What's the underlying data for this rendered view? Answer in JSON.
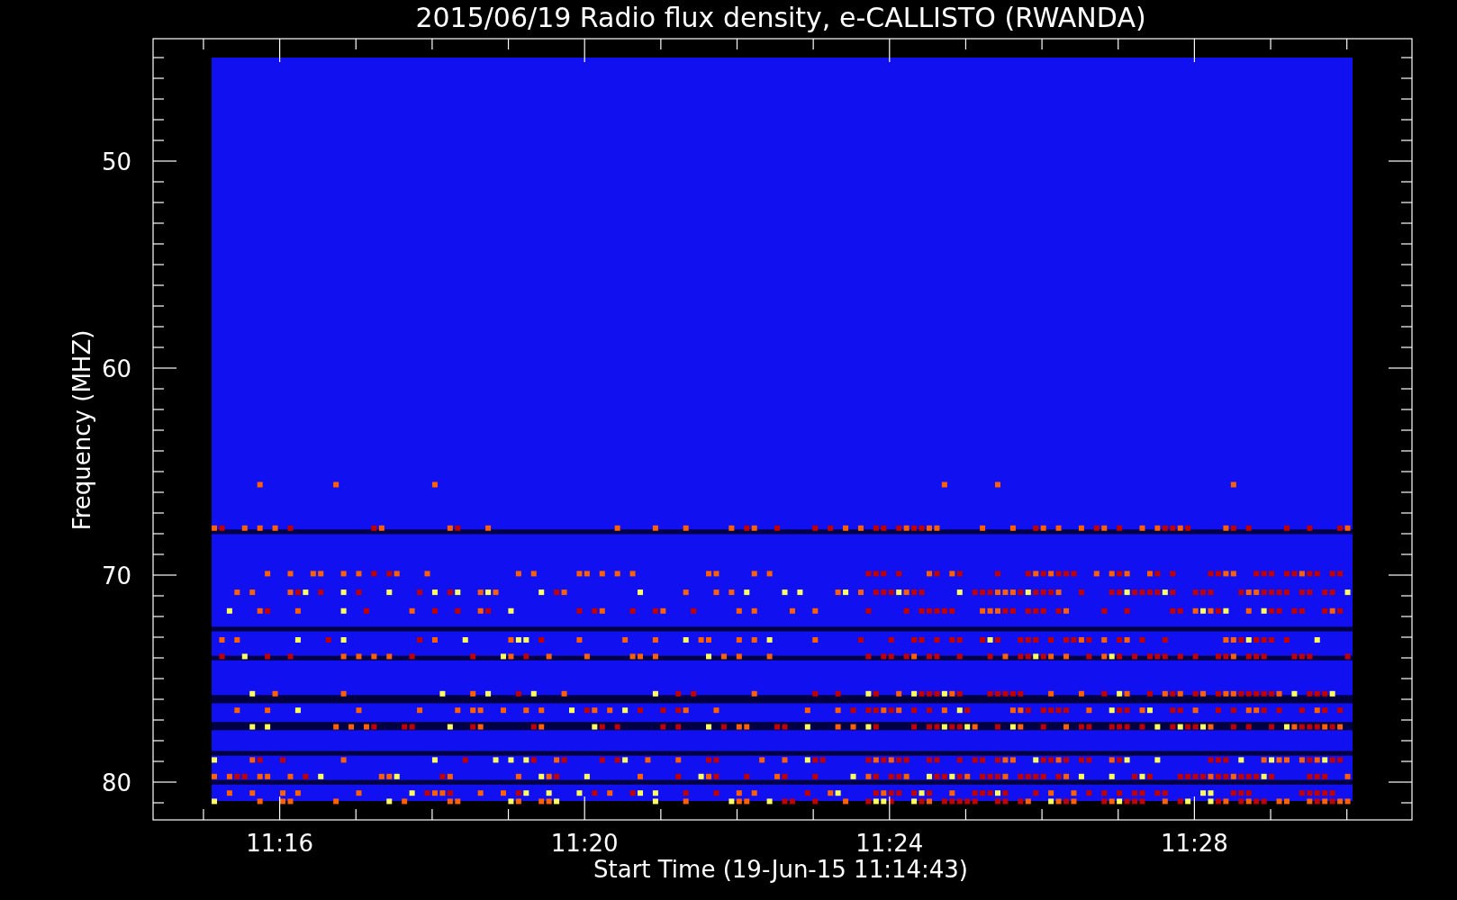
{
  "title": "2015/06/19  Radio flux density, e-CALLISTO (RWANDA)",
  "y_axis": {
    "label": "Frequency (MHZ)",
    "ticks": [
      "50",
      "60",
      "70",
      "80"
    ]
  },
  "x_axis": {
    "label": "Start Time (19-Jun-15 11:14:43)",
    "ticks": [
      "11:16",
      "11:20",
      "11:24",
      "11:28"
    ]
  }
}
